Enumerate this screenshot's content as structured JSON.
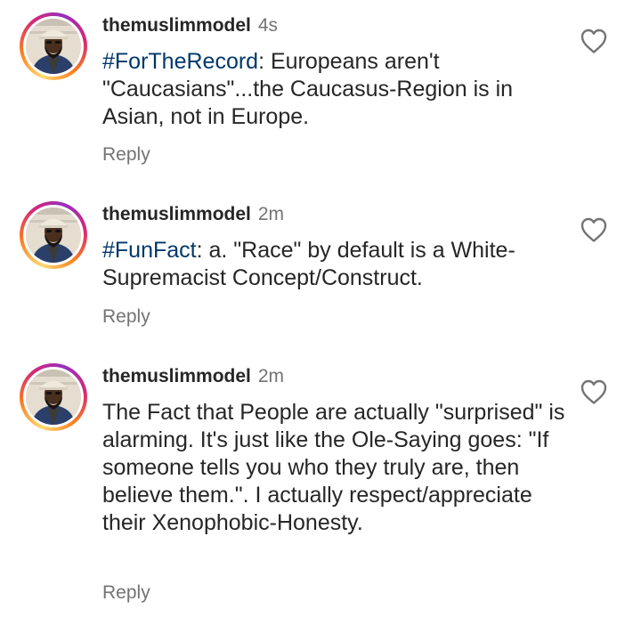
{
  "comments": [
    {
      "username": "themuslimmodel",
      "time": "4s",
      "hashtag": "#ForTheRecord",
      "text": ": Europeans aren't \"Caucasians\"...the Caucasus-Region is in Asian, not in Europe.",
      "reply_label": "Reply",
      "like_icon": "heart-outline-icon"
    },
    {
      "username": "themuslimmodel",
      "time": "2m",
      "hashtag": "#FunFact",
      "text": ": a. \"Race\" by default is a White-Supremacist Concept/Construct.",
      "reply_label": "Reply",
      "like_icon": "heart-outline-icon"
    },
    {
      "username": "themuslimmodel",
      "time": "2m",
      "hashtag": "",
      "text": "The Fact that People are actually \"surprised\" is alarming. It's just like the Ole-Saying goes: \"If someone tells you who they truly are, then believe them.\". I actually respect/appreciate their Xenophobic-Honesty.",
      "reply_label": "Reply",
      "like_icon": "heart-outline-icon"
    }
  ],
  "colors": {
    "text": "#262626",
    "secondary": "#737373",
    "hashtag": "#00376b",
    "story_ring": [
      "#feda75",
      "#fa7e1e",
      "#d62976",
      "#962fbf"
    ]
  }
}
